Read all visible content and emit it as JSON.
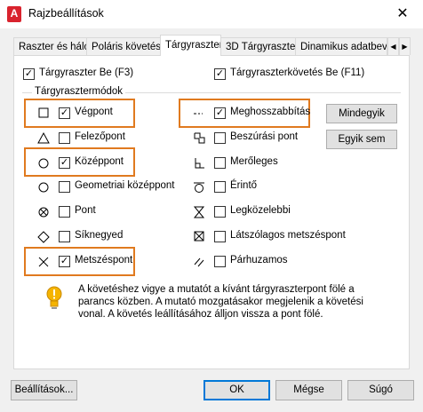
{
  "window": {
    "title": "Rajzbeállítások",
    "app_icon_letter": "A",
    "close_glyph": "✕"
  },
  "tabs": [
    {
      "label": "Raszter és háló",
      "active": false
    },
    {
      "label": "Poláris követés",
      "active": false
    },
    {
      "label": "Tárgyraszter",
      "active": true
    },
    {
      "label": "3D Tárgyraszter",
      "active": false
    },
    {
      "label": "Dinamikus adatbevit",
      "active": false
    }
  ],
  "tab_scroll": {
    "left": "◀",
    "right": "▶"
  },
  "top_options": {
    "osnap_on": {
      "label": "Tárgyraszter Be (F3)",
      "checked": true
    },
    "osnap_track": {
      "label": "Tárgyraszterkövetés Be (F11)",
      "checked": true
    }
  },
  "group_title": "Tárgyrasztermódok",
  "left_modes": [
    {
      "label": "Végpont",
      "checked": true,
      "icon": "endpoint-square-icon"
    },
    {
      "label": "Felezőpont",
      "checked": false,
      "icon": "midpoint-triangle-icon"
    },
    {
      "label": "Középpont",
      "checked": true,
      "icon": "center-circle-icon"
    },
    {
      "label": "Geometriai középpont",
      "checked": false,
      "icon": "geometric-center-icon"
    },
    {
      "label": "Pont",
      "checked": false,
      "icon": "node-icon"
    },
    {
      "label": "Síknegyed",
      "checked": false,
      "icon": "quadrant-diamond-icon"
    },
    {
      "label": "Metszéspont",
      "checked": true,
      "icon": "intersection-x-icon"
    }
  ],
  "right_modes": [
    {
      "label": "Meghosszabbítás",
      "checked": true,
      "icon": "extension-icon"
    },
    {
      "label": "Beszúrási pont",
      "checked": false,
      "icon": "insertion-icon"
    },
    {
      "label": "Merőleges",
      "checked": false,
      "icon": "perpendicular-icon"
    },
    {
      "label": "Érintő",
      "checked": false,
      "icon": "tangent-icon"
    },
    {
      "label": "Legközelebbi",
      "checked": false,
      "icon": "nearest-icon"
    },
    {
      "label": "Látszólagos metszéspont",
      "checked": false,
      "icon": "apparent-intersection-icon"
    },
    {
      "label": "Párhuzamos",
      "checked": false,
      "icon": "parallel-icon"
    }
  ],
  "side_buttons": {
    "select_all": "Mindegyik",
    "clear_all": "Egyik sem"
  },
  "info": {
    "lines": [
      "A követéshez vigye a mutatót a kívánt tárgyraszterpont fölé a",
      "parancs közben. A mutató mozgatásakor megjelenik a követési",
      "vonal. A követés leállításához álljon vissza a pont fölé."
    ]
  },
  "footer": {
    "options": "Beállítások...",
    "ok": "OK",
    "cancel": "Mégse",
    "help": "Súgó"
  },
  "colors": {
    "highlight": "#e07a1f",
    "app_icon": "#d9232e",
    "default_button_border": "#0078d7"
  }
}
